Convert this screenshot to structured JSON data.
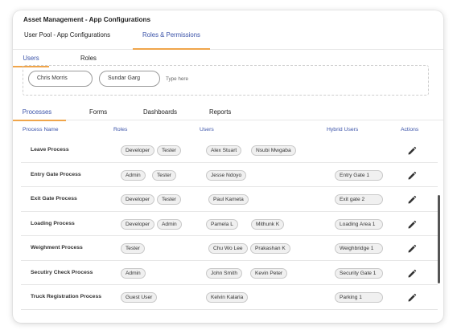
{
  "window": {
    "title": "Asset Management - App Configurations"
  },
  "top_tabs": [
    {
      "label": "User Pool - App Configurations"
    },
    {
      "label": "Roles & Permissions"
    }
  ],
  "sub_tabs": [
    {
      "label": "Users"
    },
    {
      "label": "Roles"
    }
  ],
  "user_selector": {
    "selected": [
      {
        "name": "Chris Morris"
      },
      {
        "name": "Sundar Garg"
      }
    ],
    "placeholder": "Type here"
  },
  "section_tabs": [
    {
      "label": "Processes"
    },
    {
      "label": "Forms"
    },
    {
      "label": "Dashboards"
    },
    {
      "label": "Reports"
    }
  ],
  "table": {
    "headers": {
      "name": "Process Name",
      "roles": "Roles",
      "users": "Users",
      "hybrid": "Hybrid Users",
      "actions": "Actions"
    },
    "rows": [
      {
        "name": "Leave Process",
        "roles": [
          "Developer",
          "Tester"
        ],
        "users": [
          "Alex Stuart",
          "Nsubi Mwgaba"
        ],
        "hybrid": ""
      },
      {
        "name": "Entry Gate Process",
        "roles": [
          "Admin",
          "Tester"
        ],
        "users": [
          "Jesse Ndoyo"
        ],
        "hybrid": "Entry Gate 1"
      },
      {
        "name": "Exit Gate Process",
        "roles": [
          "Developer",
          "Tester"
        ],
        "users": [
          "Paul Kameta"
        ],
        "hybrid": "Exit gate 2"
      },
      {
        "name": "Loading Process",
        "roles": [
          "Developer",
          "Admin"
        ],
        "users": [
          "Pamela L",
          "Mithunk K"
        ],
        "hybrid": "Loading Area 1"
      },
      {
        "name": "Weighment Process",
        "roles": [
          "Tester"
        ],
        "users": [
          "Chu Wo Lee",
          "Prakashan K"
        ],
        "hybrid": "Weighbridge 1"
      },
      {
        "name": "Secutiry Check Process",
        "roles": [
          "Admin"
        ],
        "users": [
          "John Smith",
          "Kevin Peter"
        ],
        "hybrid": "Security Gate 1"
      },
      {
        "name": "Truck Registration Process",
        "roles": [
          "Guest User"
        ],
        "users": [
          "Kelvin Kalaria"
        ],
        "hybrid": "Parking 1"
      }
    ]
  },
  "icons": {
    "edit": "pencil-icon"
  },
  "colors": {
    "accent": "#3a52a8",
    "tab_underline": "#f0a54a"
  }
}
